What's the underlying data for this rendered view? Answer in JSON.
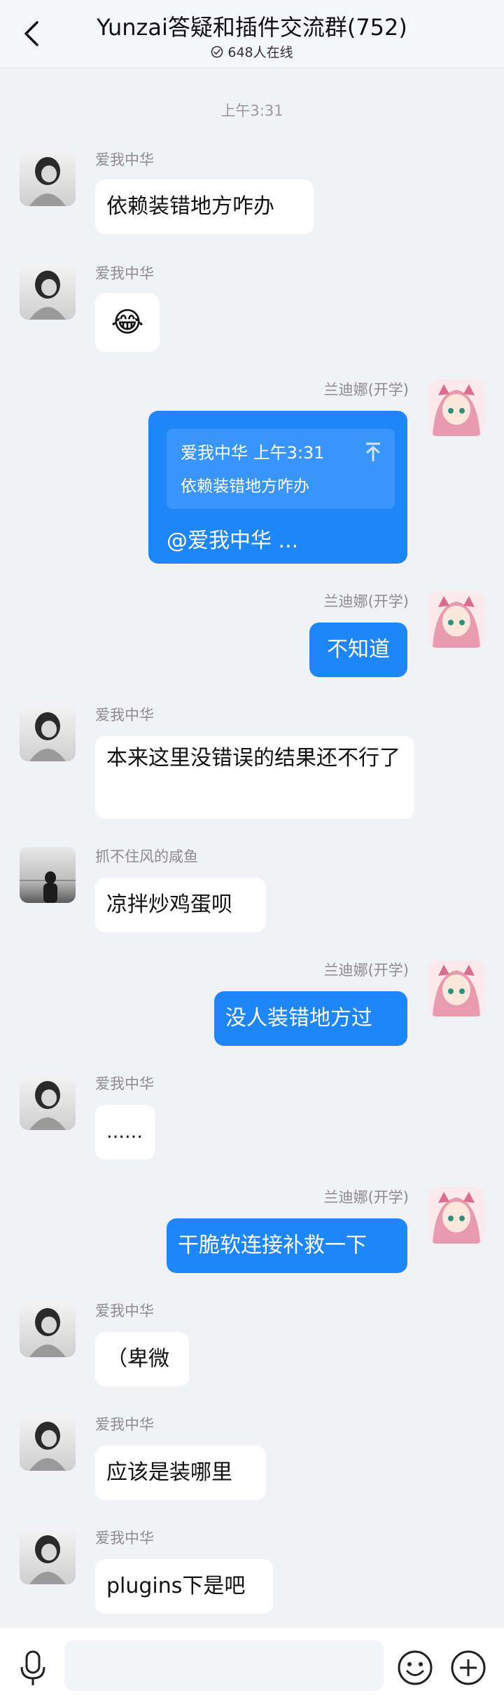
{
  "header": {
    "title": "Yunzai答疑和插件交流群(752)",
    "online": "648人在线"
  },
  "time_divider": "上午3:31",
  "messages": [
    {
      "sender": "爱我中华",
      "text": "依赖装错地方咋办"
    },
    {
      "sender": "爱我中华",
      "emoji": "😂"
    },
    {
      "sender": "兰迪娜(开学)",
      "quote_header": "爱我中华 上午3:31",
      "quote_text": "依赖装错地方咋办",
      "text": "@爱我中华 ..."
    },
    {
      "sender": "兰迪娜(开学)",
      "text": "不知道"
    },
    {
      "sender": "爱我中华",
      "text": "本来这里没错误的结果还不行了"
    },
    {
      "sender": "抓不住风的咸鱼",
      "text": "凉拌炒鸡蛋呗"
    },
    {
      "sender": "兰迪娜(开学)",
      "text": "没人装错地方过"
    },
    {
      "sender": "爱我中华",
      "text": "……"
    },
    {
      "sender": "兰迪娜(开学)",
      "text": "干脆软连接补救一下"
    },
    {
      "sender": "爱我中华",
      "text": "（卑微"
    },
    {
      "sender": "爱我中华",
      "text": "应该是装哪里"
    },
    {
      "sender": "爱我中华",
      "text": "plugins下是吧"
    }
  ],
  "composer": {
    "placeholder": ""
  },
  "icons": [
    "back-icon",
    "online-status-icon",
    "pin-up-icon",
    "voice-icon",
    "emoji-icon",
    "plus-icon"
  ],
  "colors": {
    "accent": "#1f86f7",
    "background": "#f1f2f6"
  }
}
